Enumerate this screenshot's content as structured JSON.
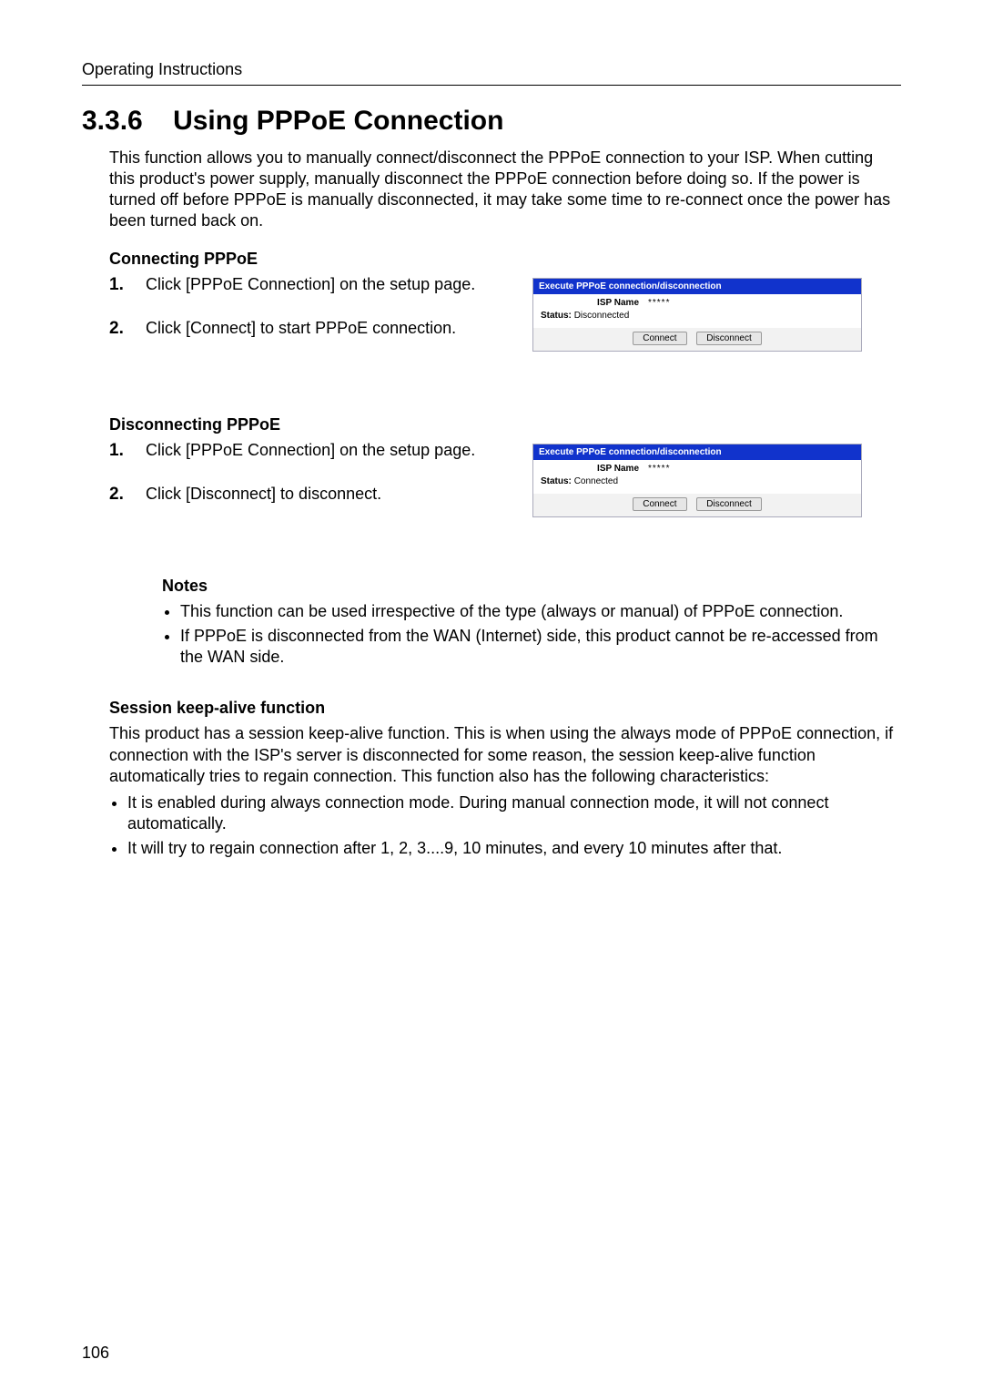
{
  "header": "Operating Instructions",
  "section_number": "3.3.6",
  "section_title": "Using PPPoE Connection",
  "intro": "This function allows you to manually connect/disconnect the PPPoE connection to your ISP. When cutting this product's power supply, manually disconnect the PPPoE connection before doing so. If the power is turned off before PPPoE is manually disconnected, it may take some time to re-connect once the power has been turned back on.",
  "connecting": {
    "heading": "Connecting PPPoE",
    "steps": [
      "Click [PPPoE Connection] on the setup page.",
      "Click [Connect] to start PPPoE connection."
    ]
  },
  "disconnecting": {
    "heading": "Disconnecting PPPoE",
    "steps": [
      "Click [PPPoE Connection] on the setup page.",
      "Click [Disconnect] to disconnect."
    ]
  },
  "panel1": {
    "title": "Execute PPPoE connection/disconnection",
    "isp_label": "ISP Name",
    "isp_value": "*****",
    "status_label": "Status:",
    "status_value": "Disconnected",
    "btn_connect": "Connect",
    "btn_disconnect": "Disconnect"
  },
  "panel2": {
    "title": "Execute PPPoE connection/disconnection",
    "isp_label": "ISP Name",
    "isp_value": "*****",
    "status_label": "Status:",
    "status_value": "Connected",
    "btn_connect": "Connect",
    "btn_disconnect": "Disconnect"
  },
  "notes": {
    "heading": "Notes",
    "items": [
      "This function can be used irrespective of the type (always or manual) of PPPoE connection.",
      "If PPPoE is disconnected from the WAN (Internet) side, this product cannot be re-accessed from the WAN side."
    ]
  },
  "keepalive": {
    "heading": "Session keep-alive function",
    "text": "This product has a session keep-alive function. This is when using the always mode of PPPoE connection, if connection with the ISP's server is disconnected for some reason, the session keep-alive function automatically tries to regain connection. This function also has the following characteristics:",
    "items": [
      "It is enabled during always connection mode. During manual connection mode, it will not connect automatically.",
      "It will try to regain connection after 1, 2, 3....9, 10 minutes, and every 10 minutes after that."
    ]
  },
  "page_number": "106"
}
